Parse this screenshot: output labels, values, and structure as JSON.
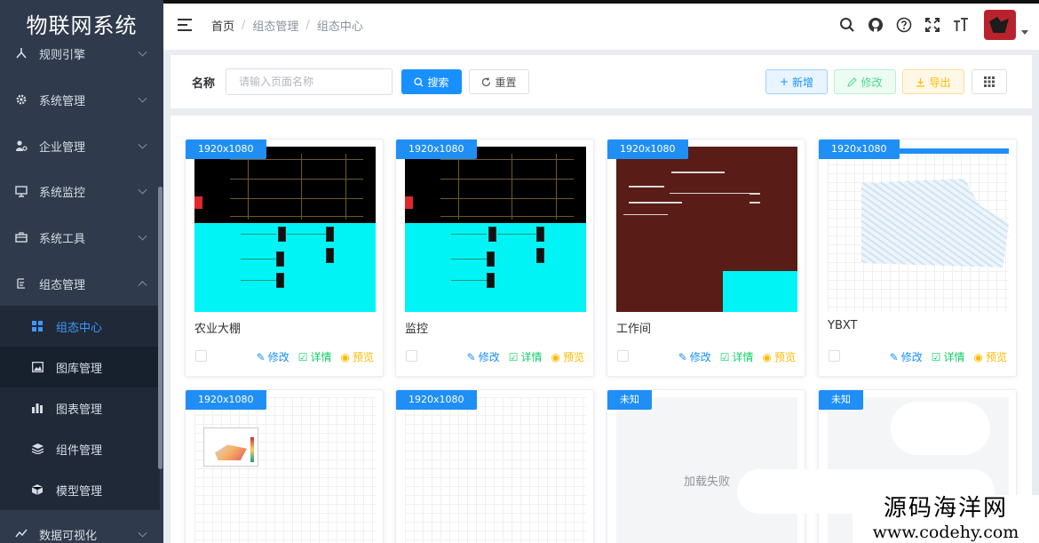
{
  "app": {
    "title": "物联网系统"
  },
  "sidebar": {
    "items": [
      {
        "label": "规则引擎",
        "icon": "rule-engine-icon"
      },
      {
        "label": "系统管理",
        "icon": "gear-icon"
      },
      {
        "label": "企业管理",
        "icon": "enterprise-icon"
      },
      {
        "label": "系统监控",
        "icon": "monitor-icon"
      },
      {
        "label": "系统工具",
        "icon": "toolbox-icon"
      },
      {
        "label": "组态管理",
        "icon": "config-icon"
      },
      {
        "label": "数据可视化",
        "icon": "visualization-icon"
      }
    ],
    "subitems": [
      {
        "label": "组态中心",
        "icon": "grid-icon",
        "active": true
      },
      {
        "label": "图库管理",
        "icon": "image-icon"
      },
      {
        "label": "图表管理",
        "icon": "bar-chart-icon"
      },
      {
        "label": "组件管理",
        "icon": "layers-icon"
      },
      {
        "label": "模型管理",
        "icon": "cube-icon"
      }
    ]
  },
  "header": {
    "breadcrumb": [
      "首页",
      "组态管理",
      "组态中心"
    ],
    "tools": [
      "search-icon",
      "github-icon",
      "help-icon",
      "fullscreen-icon",
      "font-size-icon"
    ]
  },
  "search": {
    "label": "名称",
    "placeholder": "请输入页面名称",
    "search_btn": "搜索",
    "reset_btn": "重置",
    "add_btn": "新增",
    "edit_btn": "修改",
    "export_btn": "导出"
  },
  "cards": [
    {
      "badge": "1920x1080",
      "title": "农业大棚"
    },
    {
      "badge": "1920x1080",
      "title": "监控"
    },
    {
      "badge": "1920x1080",
      "title": "工作间"
    },
    {
      "badge": "1920x1080",
      "title": "YBXT"
    },
    {
      "badge": "1920x1080"
    },
    {
      "badge": "1920x1080"
    },
    {
      "badge": "未知",
      "fail_text": "加载失败"
    },
    {
      "badge": "未知"
    }
  ],
  "card_actions": {
    "edit": "修改",
    "detail": "详情",
    "preview": "预览"
  },
  "watermark": {
    "line1": "源码海洋网",
    "line2": "www.codehy.com"
  },
  "colors": {
    "sidebar": "#2f3b4c",
    "primary": "#1890ff",
    "success": "#13ce66",
    "warning": "#ffba00",
    "active_menu": "#3e98ff"
  }
}
